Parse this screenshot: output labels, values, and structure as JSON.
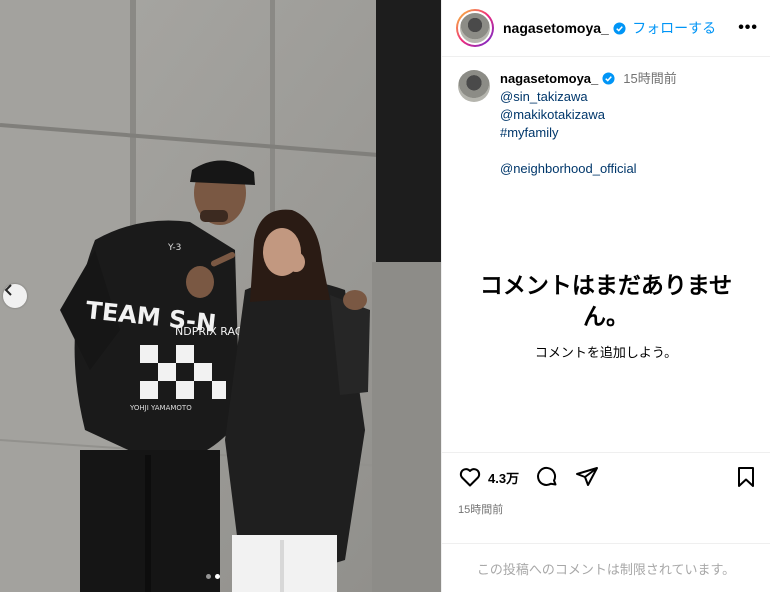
{
  "post": {
    "username": "nagasetomoya_",
    "follow_label": "フォローする",
    "more_label": "•••",
    "time_ago": "15時間前",
    "caption_lines": [
      "@sin_takizawa",
      "@makikotakizawa",
      "#myfamily"
    ],
    "caption_extra": "@neighborhood_official",
    "jacket_lines": [
      "Y-3",
      "TEAM S-N",
      "NDPRIX RAC",
      "YOHJI YAMAMOTO"
    ],
    "empty_title": "コメントはまだありません。",
    "empty_sub": "コメントを追加しよう。",
    "likes": "4.3万",
    "timestamp": "15時間前",
    "comments_limited": "この投稿へのコメントは制限されています。"
  },
  "carousel": {
    "dots": 2,
    "active_index": 1
  },
  "colors": {
    "accent": "#0095f6",
    "link": "#00376b",
    "verified": "#0095f6"
  },
  "icons": [
    "verified-badge-icon",
    "heart-icon",
    "comment-icon",
    "share-icon",
    "bookmark-icon",
    "chevron-left-icon"
  ]
}
